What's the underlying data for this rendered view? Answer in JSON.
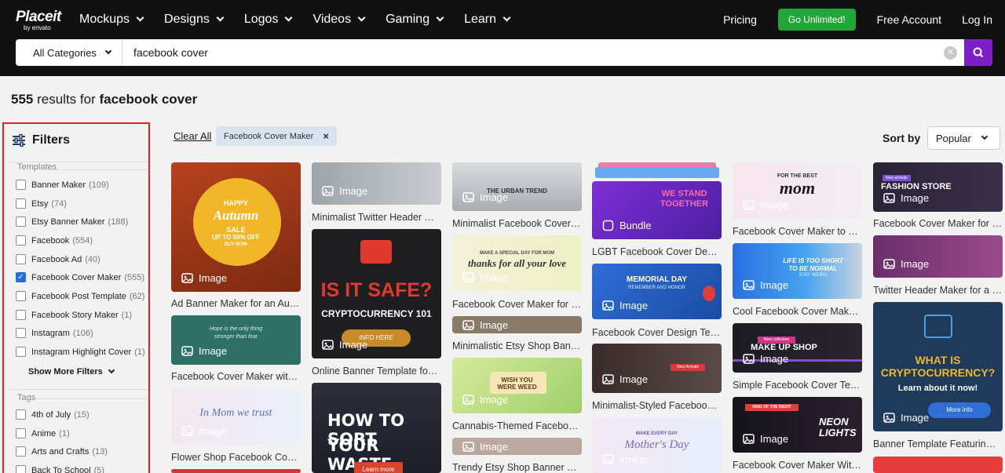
{
  "header": {
    "logo": "Placeit",
    "logo_sub": "by envato",
    "nav": [
      "Mockups",
      "Designs",
      "Logos",
      "Videos",
      "Gaming",
      "Learn"
    ],
    "pricing": "Pricing",
    "cta": "Go Unlimited!",
    "free_account": "Free Account",
    "login": "Log In"
  },
  "search": {
    "category": "All Categories",
    "query": "facebook cover"
  },
  "results": {
    "count": "555",
    "text": "results for",
    "term": "facebook cover"
  },
  "filters": {
    "title": "Filters",
    "templates_label": "Templates",
    "templates": [
      {
        "label": "Banner Maker",
        "count": "(109)",
        "checked": false
      },
      {
        "label": "Etsy",
        "count": "(74)",
        "checked": false
      },
      {
        "label": "Etsy Banner Maker",
        "count": "(188)",
        "checked": false
      },
      {
        "label": "Facebook",
        "count": "(554)",
        "checked": false
      },
      {
        "label": "Facebook Ad",
        "count": "(40)",
        "checked": false
      },
      {
        "label": "Facebook Cover Maker",
        "count": "(555)",
        "checked": true
      },
      {
        "label": "Facebook Post Template",
        "count": "(62)",
        "checked": false
      },
      {
        "label": "Facebook Story Maker",
        "count": "(1)",
        "checked": false
      },
      {
        "label": "Instagram",
        "count": "(106)",
        "checked": false
      },
      {
        "label": "Instagram Highlight Cover",
        "count": "(1)",
        "checked": false
      }
    ],
    "show_more": "Show More Filters",
    "tags_label": "Tags",
    "tags": [
      {
        "label": "4th of July",
        "count": "(15)"
      },
      {
        "label": "Anime",
        "count": "(1)"
      },
      {
        "label": "Arts and Crafts",
        "count": "(13)"
      },
      {
        "label": "Back To School",
        "count": "(5)"
      }
    ]
  },
  "toolbar": {
    "clear_all": "Clear All",
    "active_chip": "Facebook Cover Maker",
    "chip_close": "×",
    "sort_label": "Sort by",
    "sort_value": "Popular"
  },
  "colors": {
    "nav_bg": "#111111",
    "cta_green": "#23a638",
    "search_purple": "#7c1fc7",
    "checkbox_blue": "#1f6fe0",
    "highlight_red": "#e02424"
  },
  "cards": {
    "c1": {
      "badge": "Image",
      "title": "Ad Banner Maker for an Au…",
      "art": [
        "HAPPY",
        "Autumn",
        "SALE",
        "UP TO 50% OFF",
        "BUY NOW"
      ]
    },
    "c2": {
      "badge": "Image",
      "title": "Facebook Cover Maker wit…",
      "art": [
        "Hope is the only thing",
        "stronger than fear"
      ]
    },
    "c3": {
      "badge": "Image",
      "title": "Flower Shop Facebook Cov…",
      "art": [
        "In Mom we trust"
      ]
    },
    "c4": {
      "badge": "Image",
      "title": "Minimalist Twitter Header …"
    },
    "c5": {
      "badge": "Image",
      "title": "Online Banner Template fo…",
      "art": [
        "IS IT SAFE?",
        "CRYPTOCURRENCY 101",
        "INFO HERE"
      ]
    },
    "c6": {
      "art": [
        "HOW TO SORT",
        "YOUR WASTE.",
        "Learn more"
      ]
    },
    "c7": {
      "badge": "Image",
      "title": "Minimalist Facebook Cover…",
      "art": [
        "THE URBAN TREND"
      ]
    },
    "c8": {
      "badge": "Image",
      "title": "Facebook Cover Maker for …",
      "art": [
        "MAKE A SPECIAL DAY FOR MOM",
        "thanks for all your love"
      ]
    },
    "c9": {
      "badge": "Image",
      "title": "Minimalistic Etsy Shop Ban…"
    },
    "c10": {
      "badge": "Image",
      "title": "Cannabis-Themed Facebo…",
      "art": [
        "WISH YOU",
        "WERE WEED"
      ]
    },
    "c11": {
      "badge": "Image",
      "title": "Trendy Etsy Shop Banner T…"
    },
    "c12": {
      "badge": "Bundle",
      "title": "LGBT Facebook Cover Desi…",
      "art": [
        "WE STAND",
        "TOGETHER"
      ]
    },
    "c13": {
      "badge": "Image",
      "title": "Facebook Cover Design Te…",
      "art": [
        "MEMORIAL DAY",
        "REMEMBER AND HONOR"
      ]
    },
    "c14": {
      "badge": "Image",
      "title": "Minimalist-Styled Faceboo…",
      "art": [
        "New Arrivals"
      ]
    },
    "c15": {
      "badge": "Image",
      "art": [
        "MAKE EVERY DAY",
        "Mother's Day"
      ]
    },
    "c16": {
      "badge": "Image",
      "title": "Facebook Cover Maker to C…",
      "art": [
        "FOR THE BEST",
        "mom"
      ]
    },
    "c17": {
      "badge": "Image",
      "title": "Cool Facebook Cover Make…",
      "art": [
        "LIFE IS TOO SHORT",
        "TO BE NORMAL",
        "STAY WEIRD"
      ]
    },
    "c18": {
      "badge": "Image",
      "title": "Simple Facebook Cover Te…",
      "art": [
        "New collection",
        "MAKE UP SHOP"
      ]
    },
    "c19": {
      "badge": "Image",
      "title": "Facebook Cover Maker Wit…",
      "art": [
        "KING OF THE NIGHT",
        "NEON",
        "LIGHTS"
      ]
    },
    "c20": {
      "badge": "Image",
      "title": "Facebook Cover Maker for …",
      "art": [
        "New arrivals",
        "FASHION STORE"
      ]
    },
    "c21": {
      "badge": "Image",
      "title": "Twitter Header Maker for a …"
    },
    "c22": {
      "badge": "Image",
      "title": "Banner Template Featurin…",
      "art": [
        "WHAT IS",
        "CRYPTOCURRENCY?",
        "Learn about it now!",
        "More info"
      ]
    }
  }
}
